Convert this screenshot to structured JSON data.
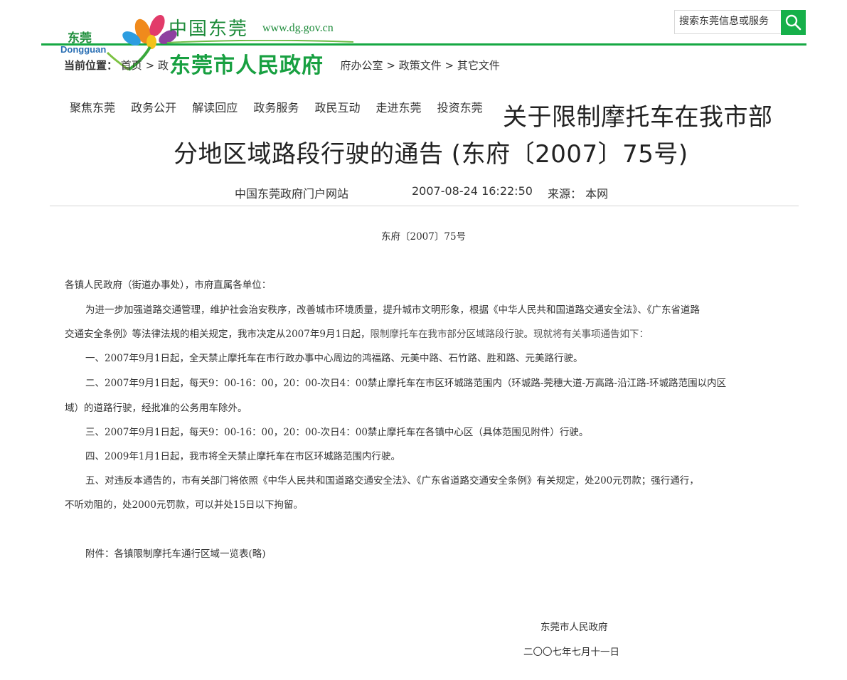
{
  "header": {
    "logo": {
      "city_cn": "东莞",
      "city_en": "Dongguan",
      "site_cn": "中国东莞",
      "url": "www.dg.gov.cn",
      "gov_name": "东莞市人民政府"
    },
    "search": {
      "placeholder": "搜索东莞信息或服务",
      "icon": "search-icon"
    },
    "accent_color": "#16a843"
  },
  "breadcrumb": {
    "label": "当前位置：",
    "items": [
      "首页",
      "政",
      "府办公室",
      "政策文件",
      "其它文件"
    ],
    "separator": ">"
  },
  "nav": {
    "items": [
      "聚焦东莞",
      "政务公开",
      "解读回应",
      "政务服务",
      "政民互动",
      "走进东莞",
      "投资东莞"
    ]
  },
  "article": {
    "title_line1": "关于限制摩托车在我市部",
    "title_line2": "分地区域路段行驶的通告 (东府〔2007〕75号)",
    "site": "中国东莞政府门户网站",
    "datetime": "2007-08-24 16:22:50",
    "source": "来源：  本网",
    "doc_number": "东府〔2007〕75号",
    "addressee": "各镇人民政府（街道办事处），市府直属各单位：",
    "lines": [
      "为进一步加强道路交通管理，维护社会治安秩序，改善城市环境质量，提升城市文明形象，根据《中华人民共和国道路交通安全法》、《广东省道路",
      "交通安全条例》等法律法规的相关规定，我市决定从2007年9月1日起，",
      "限制摩托车在我市部分区域路段行驶。现就将有关事项通告如下：",
      "一、2007年9月1日起，全天禁止摩托车在市行政办事中心周边的鸿福路、元美中路、石竹路、胜和路、元美路行驶。",
      "二、2007年9月1日起，每天9：00-16：00，20：00-次日4：00禁止摩托车在市区环城路范围内（环城路-莞穗大道-万高路-沿江路-环城路范围以内区",
      "域）的道路行驶，经批准的公务用车除外。",
      "三、2007年9月1日起，每天9：00-16：00，20：00-次日4：00禁止摩托车在各镇中心区（具体范围见附件）行驶。",
      "四、2009年1月1日起，我市将全天禁止摩托车在市区环城路范围内行驶。",
      "五、对违反本通告的，市有关部门将依照《中华人民共和国道路交通安全法》、《广东省道路交通安全条例》有关规定，处200元罚款；强行通行，",
      "不听劝阻的，处2000元罚款，可以并处15日以下拘留。"
    ],
    "attachment": "附件：各镇限制摩托车通行区域一览表(略)",
    "signature_org": "东莞市人民政府",
    "signature_date": "二〇〇七年七月十一日"
  }
}
